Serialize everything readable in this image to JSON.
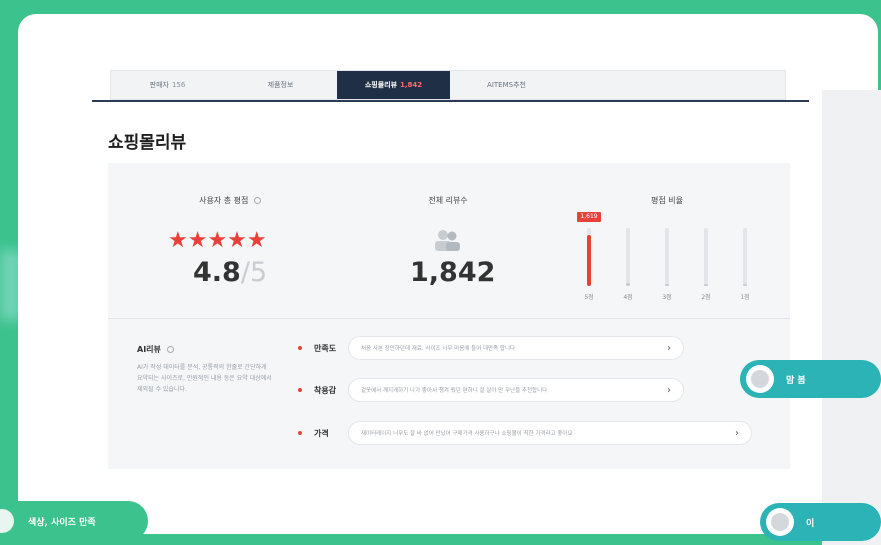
{
  "tabs": [
    {
      "label": "판매자",
      "count": "156",
      "active": false
    },
    {
      "label": "제품정보",
      "count": "",
      "active": false
    },
    {
      "label": "쇼핑몰리뷰",
      "count": "1,842",
      "active": true
    },
    {
      "label": "AITEMS추천",
      "count": "",
      "active": false
    }
  ],
  "section_title": "쇼핑몰리뷰",
  "summary": {
    "score_label": "사용자 총 평점",
    "rating": "4.8",
    "rating_max": "/5",
    "stars": "★★★★★",
    "count_label": "전체 리뷰수",
    "review_count": "1,842",
    "ratio_label": "평점 비율"
  },
  "rating_bars": [
    {
      "label": "5점",
      "fraction": 0.88
    },
    {
      "label": "4점",
      "fraction": 0.06
    },
    {
      "label": "3점",
      "fraction": 0.02
    },
    {
      "label": "2점",
      "fraction": 0.01
    },
    {
      "label": "1점",
      "fraction": 0.01
    }
  ],
  "rating_badge": "1,619",
  "ai_review": {
    "title": "AI리뷰",
    "description": "AI가 작성 데이터를 분석, 공통적의 한줄로 간단하게 요약되는 사이즈로, 만원적인 내용 등은 요약 대상에서 제외될 수 있습니다."
  },
  "keywords": [
    {
      "name": "만족도",
      "text": "처음 사본 장만하던데 재료, 사이즈 너무 마음에 들어 대만족 합니다"
    },
    {
      "name": "착용감",
      "text": "겉옷에서 깨지게하기 나가 좋아서 챙겨 줬던 편하니 잘 살아 만 무난을 추천합니다"
    },
    {
      "name": "가격",
      "text": "재이터레이지 너무도 잘 바 없어 만났어 구매가격 사용하구나 쇼핑몰이 착한 가격라고 좋아요"
    }
  ],
  "bubbles": {
    "right_top_label": "맘 봄",
    "right_bottom_label": "이",
    "bottom_left_label": "색상, 사이즈 만족"
  },
  "colors": {
    "accent_red": "#e8413a",
    "navy": "#1f2f45",
    "green_bg": "#3cc28c",
    "teal_bubble": "#2bb3b5"
  }
}
